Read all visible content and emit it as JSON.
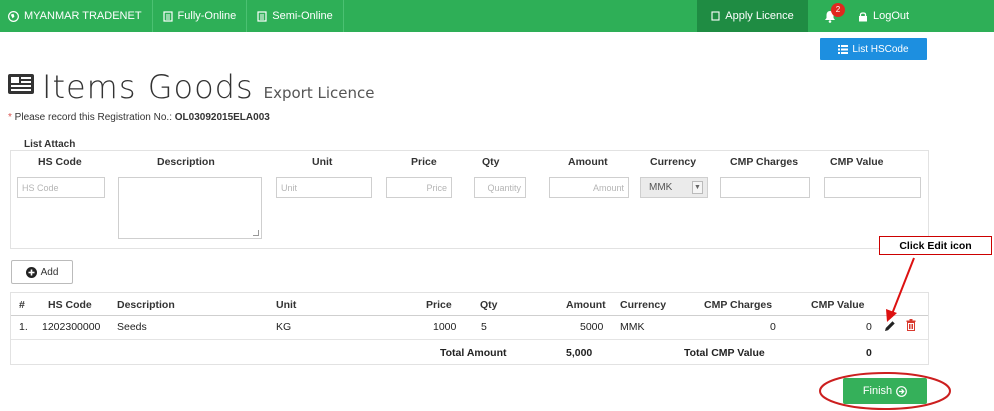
{
  "navbar": {
    "brand": "MYANMAR TRADENET",
    "fully_online": "Fully-Online",
    "semi_online": "Semi-Online",
    "apply_licence": "Apply Licence",
    "notification_count": "2",
    "logout": "LogOut",
    "color": "#2eaf57"
  },
  "toolbar": {
    "list_hscode": "List HSCode"
  },
  "page": {
    "title": "Items Goods",
    "subtitle": "Export Licence",
    "notice_prefix": "* ",
    "notice_text": "Please record this Registration No.: ",
    "registration_no": "OL03092015ELA003",
    "list_attach": "List Attach"
  },
  "entry_form": {
    "headers": {
      "hs_code": "HS Code",
      "description": "Description",
      "unit": "Unit",
      "price": "Price",
      "qty": "Qty",
      "amount": "Amount",
      "currency": "Currency",
      "cmp_charges": "CMP Charges",
      "cmp_value": "CMP Value"
    },
    "placeholders": {
      "hs_code": "HS Code",
      "unit": "Unit",
      "price": "Price",
      "qty": "Quantity",
      "amount": "Amount"
    },
    "currency_selected": "MMK",
    "add_label": "Add"
  },
  "annotation": {
    "callout": "Click Edit icon"
  },
  "items_table": {
    "headers": {
      "num": "#",
      "hs_code": "HS Code",
      "description": "Description",
      "unit": "Unit",
      "price": "Price",
      "qty": "Qty",
      "amount": "Amount",
      "currency": "Currency",
      "cmp_charges": "CMP Charges",
      "cmp_value": "CMP Value"
    },
    "rows": [
      {
        "num": "1.",
        "hs_code": "1202300000",
        "description": "Seeds",
        "unit": "KG",
        "price": "1000",
        "qty": "5",
        "amount": "5000",
        "currency": "MMK",
        "cmp_charges": "0",
        "cmp_value": "0"
      }
    ],
    "footer": {
      "total_amount_label": "Total Amount",
      "total_amount": "5,000",
      "total_cmp_label": "Total CMP Value",
      "total_cmp": "0"
    }
  },
  "finish_label": "Finish"
}
